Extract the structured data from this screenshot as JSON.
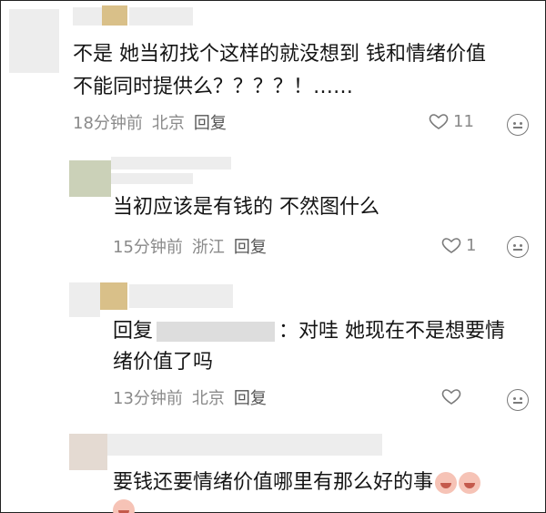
{
  "comments": [
    {
      "text": "不是 她当初找个这样的就没想到 钱和情绪价值不能同时提供么？？？？！……",
      "line1": "不是 她当初找个这样的就没想到 钱和情绪价值",
      "line2": "不能同时提供么？？？？！……",
      "time": "18分钟前",
      "location": "北京",
      "reply": "回复",
      "likes": "11"
    },
    {
      "text": "当初应该是有钱的 不然图什么",
      "time": "15分钟前",
      "location": "浙江",
      "reply": "回复",
      "likes": "1"
    },
    {
      "prefix": "回复",
      "suffix": "：对哇 她现在不是想要情",
      "line2": "绪价值了吗",
      "time": "13分钟前",
      "location": "北京",
      "reply": "回复",
      "likes": ""
    },
    {
      "text": "要钱还要情绪价值哪里有那么好的事",
      "icons": [
        "crying-emoji-icon",
        "crying-emoji-icon",
        "crying-emoji-icon"
      ]
    }
  ]
}
